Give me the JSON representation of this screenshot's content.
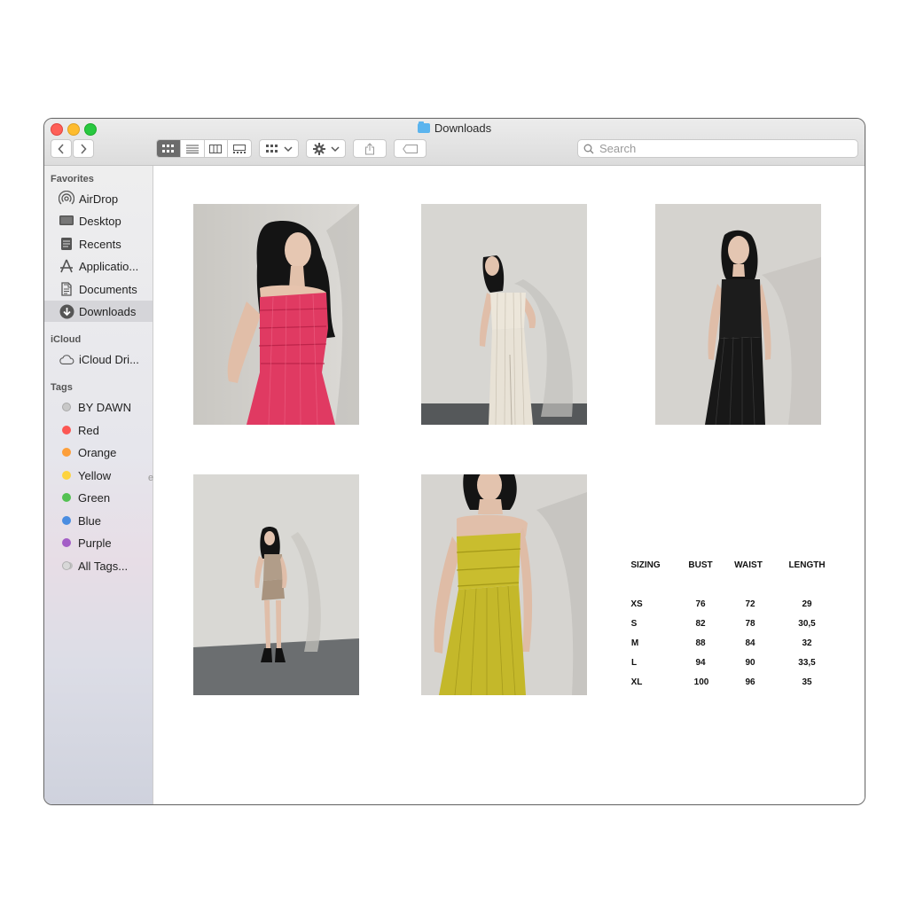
{
  "window": {
    "title": "Downloads"
  },
  "toolbar": {
    "back_icon": "chevron-left-icon",
    "forward_icon": "chevron-right-icon",
    "views": [
      "icon-view",
      "list-view",
      "column-view",
      "gallery-view"
    ],
    "active_view": "icon-view"
  },
  "search": {
    "placeholder": "Search"
  },
  "sidebar": {
    "favorites_header": "Favorites",
    "favorites": [
      {
        "label": "AirDrop",
        "icon": "airdrop-icon"
      },
      {
        "label": "Desktop",
        "icon": "desktop-icon"
      },
      {
        "label": "Recents",
        "icon": "recents-icon"
      },
      {
        "label": "Applicatio...",
        "icon": "applications-icon"
      },
      {
        "label": "Documents",
        "icon": "documents-icon"
      },
      {
        "label": "Downloads",
        "icon": "downloads-icon",
        "selected": true
      }
    ],
    "icloud_header": "iCloud",
    "icloud": [
      {
        "label": "iCloud Dri...",
        "icon": "cloud-icon"
      }
    ],
    "tags_header": "Tags",
    "tags": [
      {
        "label": "BY DAWN",
        "color": "#c8c8c8"
      },
      {
        "label": "Red",
        "color": "#fc5753"
      },
      {
        "label": "Orange",
        "color": "#fd9f3a"
      },
      {
        "label": "Yellow",
        "color": "#fdd33f"
      },
      {
        "label": "Green",
        "color": "#53c152"
      },
      {
        "label": "Blue",
        "color": "#4a8de1"
      },
      {
        "label": "Purple",
        "color": "#a35ec7"
      },
      {
        "label": "All Tags...",
        "color": "#d8d8d8"
      }
    ]
  },
  "photos": [
    {
      "name": "photo-pink-top",
      "garment_color": "#e03a62"
    },
    {
      "name": "photo-white-set",
      "garment_color": "#ece6da"
    },
    {
      "name": "photo-black-set",
      "garment_color": "#1c1c1c"
    },
    {
      "name": "photo-taupe-set",
      "garment_color": "#b19d89"
    },
    {
      "name": "photo-chartreuse-set",
      "garment_color": "#c9bd2e"
    }
  ],
  "sizing": {
    "headers": [
      "SIZING",
      "BUST",
      "WAIST",
      "LENGTH"
    ],
    "rows": [
      [
        "XS",
        "76",
        "72",
        "29"
      ],
      [
        "S",
        "82",
        "78",
        "30,5"
      ],
      [
        "M",
        "88",
        "84",
        "32"
      ],
      [
        "L",
        "94",
        "90",
        "33,5"
      ],
      [
        "XL",
        "100",
        "96",
        "35"
      ]
    ]
  },
  "stray_mark": "e"
}
